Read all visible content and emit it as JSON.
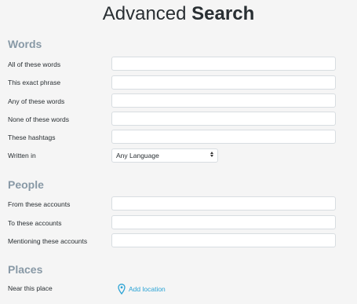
{
  "page": {
    "title_light": "Advanced ",
    "title_bold": "Search"
  },
  "colors": {
    "section_header": "#8899a6",
    "link": "#2aa3d5",
    "input_border": "#d8dde1",
    "background": "#f5f5f5"
  },
  "words": {
    "heading": "Words",
    "all_label": "All of these words",
    "all_value": "",
    "exact_label": "This exact phrase",
    "exact_value": "",
    "any_label": "Any of these words",
    "any_value": "",
    "none_label": "None of these words",
    "none_value": "",
    "hashtags_label": "These hashtags",
    "hashtags_value": "",
    "language_label": "Written in",
    "language_selected": "Any Language"
  },
  "people": {
    "heading": "People",
    "from_label": "From these accounts",
    "from_value": "",
    "to_label": "To these accounts",
    "to_value": "",
    "mentioning_label": "Mentioning these accounts",
    "mentioning_value": ""
  },
  "places": {
    "heading": "Places",
    "near_label": "Near this place",
    "add_location_label": "Add location",
    "add_location_icon": "map-pin-icon"
  }
}
